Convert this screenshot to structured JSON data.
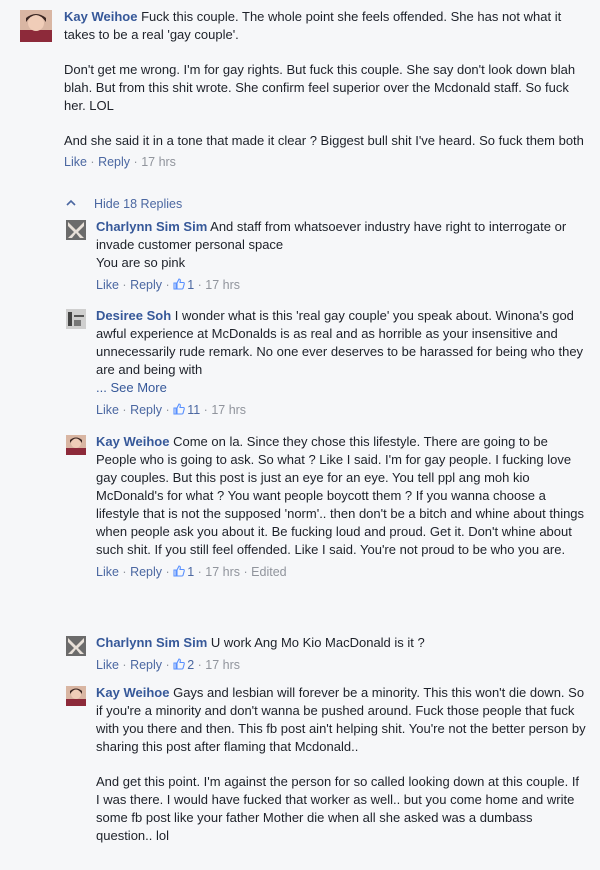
{
  "top_comment": {
    "author": "Kay Weihoe",
    "paragraphs": [
      "Fuck this couple. The whole point she feels offended. She has not what it takes to be a real 'gay couple'.",
      "Don't get me wrong. I'm for gay rights. But fuck this couple. She say don't look down blah blah. But from this shit wrote. She confirm feel superior over the Mcdonald staff. So fuck her. LOL",
      "And she said it in a tone that made it clear ? Biggest bull shit I've heard. So fuck them both"
    ],
    "like_label": "Like",
    "reply_label": "Reply",
    "time": "17 hrs"
  },
  "hide_replies_label": "Hide 18 Replies",
  "replies": [
    {
      "author": "Charlynn Sim Sim",
      "paragraphs": [
        "And staff from whatsoever industry have right to interrogate or invade customer personal space",
        "You are so pink"
      ],
      "like_label": "Like",
      "reply_label": "Reply",
      "likes": "1",
      "time": "17 hrs"
    },
    {
      "author": "Desiree Soh",
      "paragraphs": [
        "I wonder what is this 'real gay couple' you speak about. Winona's god awful experience at McDonalds is as real and as horrible as your insensitive and unnecessarily rude remark. No one ever deserves to be harassed for being who they are and being with"
      ],
      "see_more": "... See More",
      "like_label": "Like",
      "reply_label": "Reply",
      "likes": "11",
      "time": "17 hrs"
    },
    {
      "author": "Kay Weihoe",
      "paragraphs": [
        "Come on la. Since they chose this lifestyle. There are going to be People who is going to ask. So what ? Like I said. I'm for gay people. I fucking love gay couples. But this post is just an eye for an eye. You tell ppl ang moh kio McDonald's for what ? You want people boycott them ? If you wanna choose a lifestyle that is not the supposed 'norm'.. then don't be a bitch and whine about things when people ask you about it. Be fucking loud and proud. Get it. Don't whine about such shit. If you still feel offended. Like I said. You're not proud to be who you are."
      ],
      "like_label": "Like",
      "reply_label": "Reply",
      "likes": "1",
      "time": "17 hrs",
      "edited": "Edited"
    },
    {
      "author": "Charlynn Sim Sim",
      "paragraphs": [
        "U work Ang Mo Kio MacDonald is it ?"
      ],
      "like_label": "Like",
      "reply_label": "Reply",
      "likes": "2",
      "time": "17 hrs"
    },
    {
      "author": "Kay Weihoe",
      "paragraphs": [
        "Gays and lesbian will forever be a minority. This this won't die down. So if you're a minority and don't wanna be pushed around. Fuck those people that fuck with you there and then. This fb post ain't helping shit. You're not the better person by sharing this post after flaming that Mcdonald..",
        "And get this point. I'm against the person for so called looking down at this couple. If I was there. I would have fucked that worker as well.. but you come home and write some fb post like your father Mother die when all she asked was a dumbass question.. lol"
      ]
    }
  ],
  "icons": {
    "like": "thumbs-up-icon",
    "hide": "chevron-up-icon"
  },
  "colors": {
    "name": "#365899",
    "link": "#4b67a1",
    "meta": "#90949c",
    "like_icon": "#5890ff",
    "background": "#f6f7f9"
  }
}
